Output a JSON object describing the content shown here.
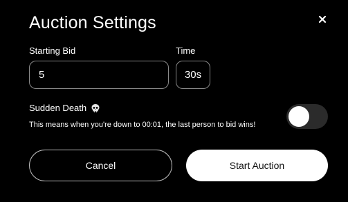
{
  "modal": {
    "title": "Auction Settings",
    "close_icon": "close-icon"
  },
  "starting_bid": {
    "label": "Starting Bid",
    "value": "5"
  },
  "time": {
    "label": "Time",
    "value": "30s"
  },
  "sudden_death": {
    "label": "Sudden Death",
    "icon": "skull-icon",
    "description": "This means when you're down to 00:01, the last person to bid wins!",
    "enabled": false
  },
  "buttons": {
    "cancel_label": "Cancel",
    "start_label": "Start Auction"
  }
}
